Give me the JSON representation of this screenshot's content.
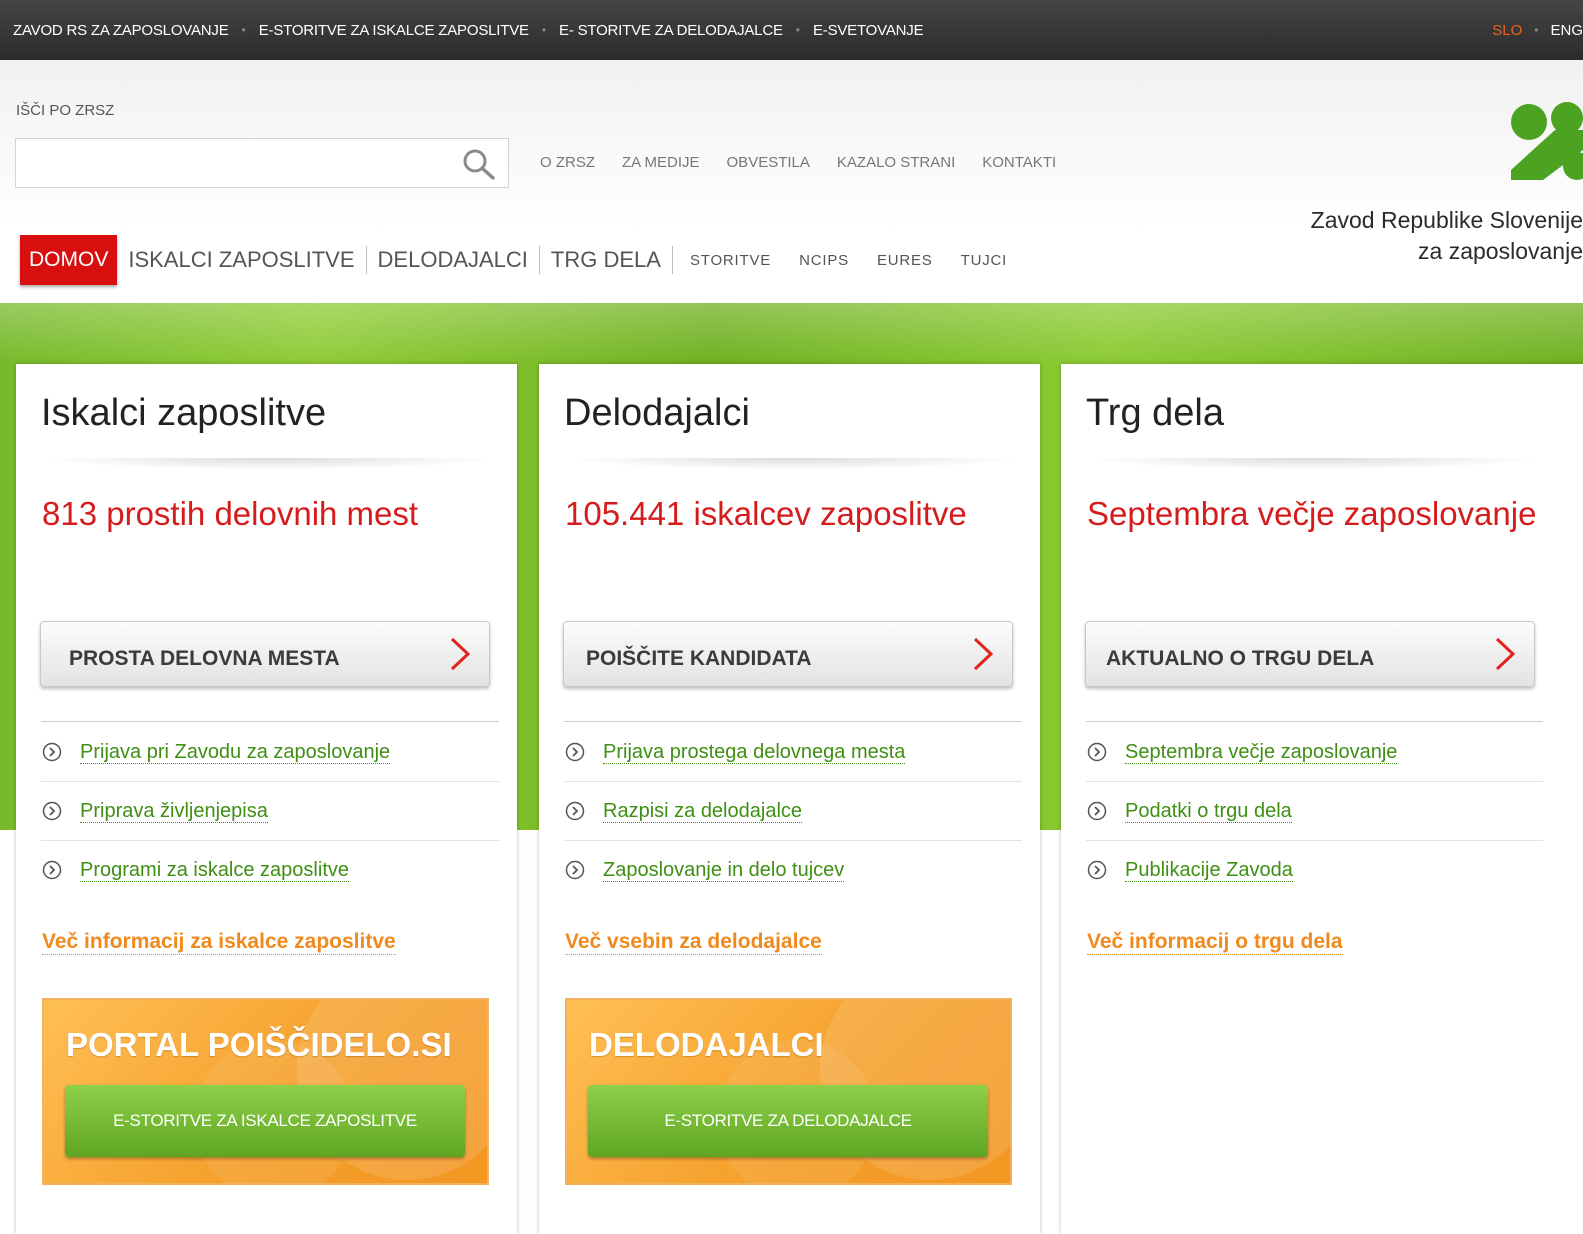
{
  "topbar": {
    "links": [
      "ZAVOD RS ZA ZAPOSLOVANJE",
      "E-STORITVE ZA ISKALCE ZAPOSLITVE",
      "E- STORITVE ZA DELODAJALCE",
      "E-SVETOVANJE"
    ],
    "lang_active": "SLO",
    "lang_other": "ENG",
    "lang_active_color": "#e8641e"
  },
  "search": {
    "label": "IŠČI PO ZRSZ",
    "placeholder": ""
  },
  "util_nav": [
    "O ZRSZ",
    "ZA MEDIJE",
    "OBVESTILA",
    "KAZALO STRANI",
    "KONTAKTI"
  ],
  "main_nav": {
    "home": "DOMOV",
    "big_items": [
      "ISKALCI ZAPOSLITVE",
      "DELODAJALCI",
      "TRG DELA"
    ],
    "small_items": [
      "STORITVE",
      "NCIPS",
      "EURES",
      "TUJCI"
    ]
  },
  "org": {
    "name_line1": "Zavod Republike Slovenije",
    "name_line2": "za zaposlovanje",
    "brand_green": "#4ba321"
  },
  "cards": [
    {
      "title": "Iskalci zaposlitve",
      "stat": "813 prostih delovnih mest",
      "cta": "PROSTA DELOVNA MESTA",
      "links": [
        "Prijava pri Zavodu za zaposlovanje",
        "Priprava življenjepisa",
        "Programi za iskalce zaposlitve"
      ],
      "more": "Več informacij za iskalce zaposlitve",
      "promo_title": "PORTAL POIŠČIDELO.SI",
      "promo_button": "E-STORITVE ZA ISKALCE ZAPOSLITVE"
    },
    {
      "title": "Delodajalci",
      "stat": "105.441 iskalcev zaposlitve",
      "cta": "POIŠČITE KANDIDATA",
      "links": [
        "Prijava prostega delovnega mesta",
        "Razpisi za delodajalce",
        "Zaposlovanje in delo tujcev"
      ],
      "more": "Več vsebin za delodajalce",
      "promo_title": "DELODAJALCI",
      "promo_button": "E-STORITVE ZA DELODAJALCE"
    },
    {
      "title": "Trg dela",
      "stat": "Septembra večje zaposlovanje",
      "cta": "AKTUALNO O TRGU DELA",
      "links": [
        "Septembra večje zaposlovanje",
        "Podatki o trgu dela",
        "Publikacije Zavoda"
      ],
      "more": "Več informacij o trgu dela"
    }
  ],
  "colors": {
    "accent_red": "#d80f0f",
    "stat_red": "#d51c1c",
    "link_green": "#3f8f14",
    "more_orange": "#f08a1e"
  }
}
